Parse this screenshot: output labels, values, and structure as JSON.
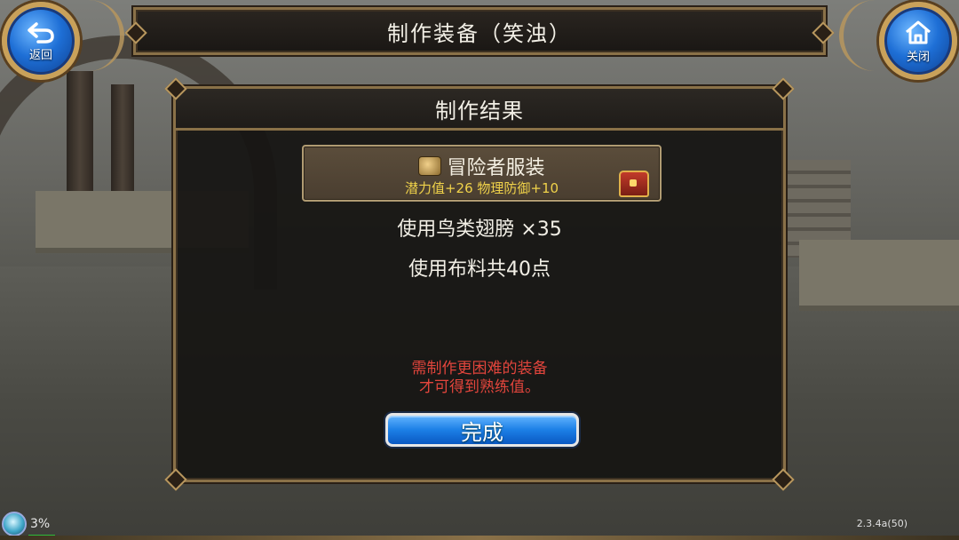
{
  "header": {
    "title": "制作装备（笑浊）",
    "back_label": "返回",
    "close_label": "关闭"
  },
  "dialog": {
    "title": "制作结果",
    "item": {
      "name": "冒险者服装",
      "stats": "潜力值+26 物理防御+10",
      "icon": "leather-armor-icon",
      "badge_icon": "treasure-chest-icon"
    },
    "material_line": "使用鸟类翅膀 ×35",
    "cloth_line": "使用布料共40点",
    "note_line1": "需制作更困难的装备",
    "note_line2": "才可得到熟练值。",
    "done_label": "完成"
  },
  "status": {
    "percent": "3%",
    "version": "2.3.4a(50)"
  },
  "colors": {
    "frame_gold": "#8a7148",
    "stat_yellow": "#f0d24a",
    "note_red": "#e2453c",
    "button_blue": "#1c7fe6"
  }
}
